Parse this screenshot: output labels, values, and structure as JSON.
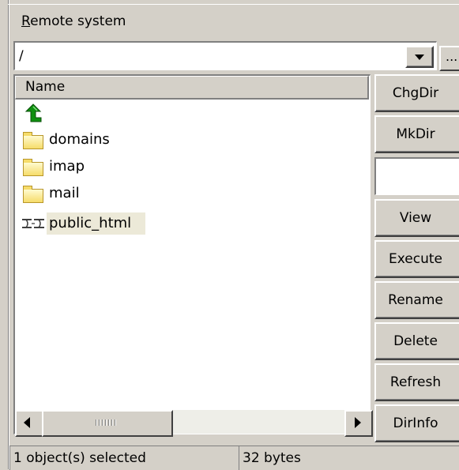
{
  "panel": {
    "title_accel": "R",
    "title_rest": "emote system"
  },
  "path": {
    "value": "/",
    "browse_label": "..."
  },
  "file_list": {
    "column_name": "Name",
    "rows": [
      {
        "icon": "up-arrow-icon",
        "name": ""
      },
      {
        "icon": "folder-icon",
        "name": "domains"
      },
      {
        "icon": "folder-icon",
        "name": "imap"
      },
      {
        "icon": "folder-icon",
        "name": "mail"
      },
      {
        "icon": "link-icon",
        "name": "public_html"
      }
    ],
    "scrollbar_thumb_fraction": 0.42
  },
  "side_buttons": {
    "chgdir": "ChgDir",
    "mkdir": "MkDir",
    "view": "View",
    "execute": "Execute",
    "rename": "Rename",
    "delete": "Delete",
    "refresh": "Refresh",
    "dirinfo": "DirInfo"
  },
  "status": {
    "selection": "1 object(s) selected",
    "size": "32 bytes"
  },
  "colors": {
    "face": "#d4d0c8",
    "up_arrow": "#109010",
    "folder": "#f6dc6a"
  }
}
